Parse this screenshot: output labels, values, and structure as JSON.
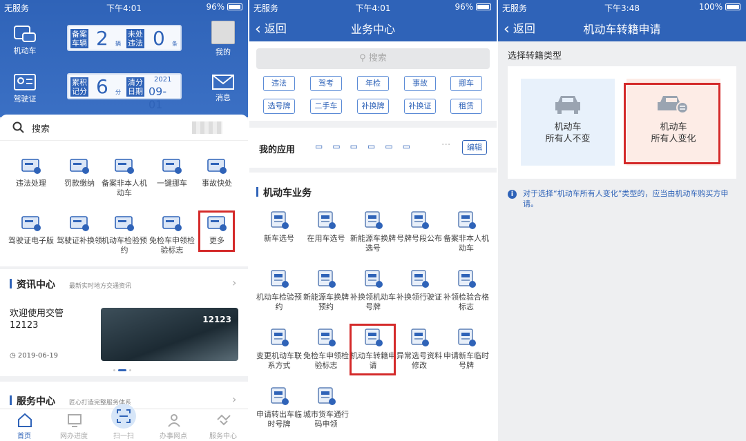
{
  "colors": {
    "primary": "#2f63b8",
    "highlight": "#d42a2a",
    "choice_bg": "#e8f1fb",
    "choice_selected_bg": "#fdece6"
  },
  "panel1": {
    "status": {
      "carrier": "无服务",
      "time": "下午4:01",
      "battery": "96%",
      "battery_level": 0.96
    },
    "header": {
      "vehicle_label": "机动车",
      "license_label": "驾驶证",
      "profile_label": "我的",
      "message_label": "消息",
      "card1": {
        "label_a": "备案车辆",
        "value_a": "2",
        "unit_a": "辆",
        "label_b": "未处违法",
        "value_b": "0",
        "unit_b": "条"
      },
      "card2": {
        "label_a": "累积记分",
        "value_a": "6",
        "unit_a": "分",
        "label_b": "清分日期",
        "year": "2021",
        "date": "09-01"
      }
    },
    "search_label": "搜索",
    "grid": [
      {
        "label": "违法处理",
        "icon": "car-violation-icon"
      },
      {
        "label": "罚款缴纳",
        "icon": "fine-payment-icon"
      },
      {
        "label": "备案非本人机动车",
        "icon": "register-vehicle-icon"
      },
      {
        "label": "一键挪车",
        "icon": "move-car-icon"
      },
      {
        "label": "事故快处",
        "icon": "accident-icon"
      },
      {
        "label": "驾驶证电子版",
        "icon": "e-license-icon"
      },
      {
        "label": "驾驶证补换领",
        "icon": "license-replace-icon"
      },
      {
        "label": "机动车检验预约",
        "icon": "inspection-booking-icon"
      },
      {
        "label": "免检车申领检验标志",
        "icon": "exempt-inspection-icon"
      },
      {
        "label": "更多",
        "icon": "more-icon"
      }
    ],
    "news": {
      "title": "资讯中心",
      "subtitle": "最新实时地方交通资讯",
      "headline": "欢迎使用交管12123",
      "date": "2019-06-19",
      "banner_text": "12123"
    },
    "service": {
      "title": "服务中心",
      "subtitle": "匠心打造完整服务体系"
    },
    "tabs": [
      "首页",
      "网办进度",
      "扫一扫",
      "办事网点",
      "服务中心"
    ]
  },
  "panel2": {
    "status": {
      "carrier": "无服务",
      "time": "下午4:01",
      "battery": "96%",
      "battery_level": 0.96
    },
    "nav": {
      "back": "返回",
      "title": "业务中心"
    },
    "search_placeholder": "搜索",
    "tags": [
      "违法",
      "驾考",
      "年检",
      "事故",
      "挪车",
      "选号牌",
      "二手车",
      "补换牌",
      "补换证",
      "租赁"
    ],
    "my_apps": {
      "title": "我的应用",
      "edit": "编辑"
    },
    "section_title": "机动车业务",
    "tiles": [
      "新车选号",
      "在用车选号",
      "新能源车换牌选号",
      "号牌号段公布",
      "备案非本人机动车",
      "机动车检验预约",
      "新能源车换牌预约",
      "补换领机动车号牌",
      "补换领行驶证",
      "补领检验合格标志",
      "变更机动车联系方式",
      "免检车申领检验标志",
      "机动车转籍申请",
      "异常选号资料修改",
      "申请新车临时号牌",
      "申请转出车临时号牌",
      "城市货车通行码申领"
    ]
  },
  "panel3": {
    "status": {
      "carrier": "无服务",
      "time": "下午3:48",
      "battery": "100%",
      "battery_level": 1.0
    },
    "nav": {
      "back": "返回",
      "title": "机动车转籍申请"
    },
    "section_label": "选择转籍类型",
    "choices": [
      {
        "line1": "机动车",
        "line2": "所有人不变"
      },
      {
        "line1": "机动车",
        "line2": "所有人变化"
      }
    ],
    "note": "对于选择“机动车所有人变化”类型的，应当由机动车购买方申请。"
  }
}
